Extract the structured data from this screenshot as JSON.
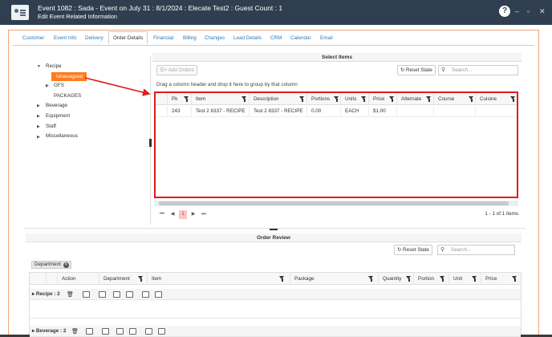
{
  "window": {
    "title": "Event 1082 : Sada - Event on July 31 : 8/1/2024 : Elecate Test2 : Guest Count : 1",
    "subtitle": "Edit Event Related Information",
    "help_icon": "question-icon",
    "minimize": "–",
    "maximize": "▫",
    "close": "✕"
  },
  "tabs": [
    "Customer",
    "Event Info",
    "Delivery",
    "Order Details",
    "Financial",
    "Billing",
    "Changes",
    "Lead Details",
    "CRM",
    "Calendar",
    "Email"
  ],
  "active_tab": "Order Details",
  "tree": {
    "recipe": "Recipe",
    "unassigned": "Unassigned",
    "gfs": "GFS",
    "packages": "PACKAGES",
    "beverage": "Beverage",
    "equipment": "Equipment",
    "staff": "Staff",
    "misc": "Miscellaneous"
  },
  "select_items": {
    "header": "Select Items",
    "add_orders": "Add Orders",
    "reset_state": "Reset State",
    "search_placeholder": "Search...",
    "group_hint": "Drag a column header and drop it here to group by that column",
    "columns": [
      "Pk",
      "Item",
      "Description",
      "Portions",
      "Units",
      "Price",
      "Alternate",
      "Course",
      "Cuisine"
    ],
    "rows": [
      {
        "pk": "243",
        "item": "Test 2 8337 - RECIPE",
        "description": "Test 2 8337 - RECIPE",
        "portions": "0.00",
        "units": "EACH",
        "price": "$1.00",
        "alternate": "",
        "course": "",
        "cuisine": ""
      }
    ],
    "pager": {
      "current": "1",
      "info": "1 - 1 of 1 items",
      "first": "⏮",
      "prev": "◀",
      "next": "▶",
      "last": "⏭"
    }
  },
  "order_review": {
    "header": "Order Review",
    "reset_state": "Reset State",
    "search_placeholder": "Search...",
    "group_chip": "Department",
    "columns": [
      "Action",
      "Department",
      "Item",
      "Package",
      "Quantity",
      "Portion",
      "Unit",
      "Price"
    ],
    "groups": [
      "Recipe : 2",
      "Beverage : 2"
    ]
  },
  "colors": {
    "titlebar": "#303f4f",
    "accent": "#ff7a1e",
    "highlight_box": "#e01c1c"
  }
}
